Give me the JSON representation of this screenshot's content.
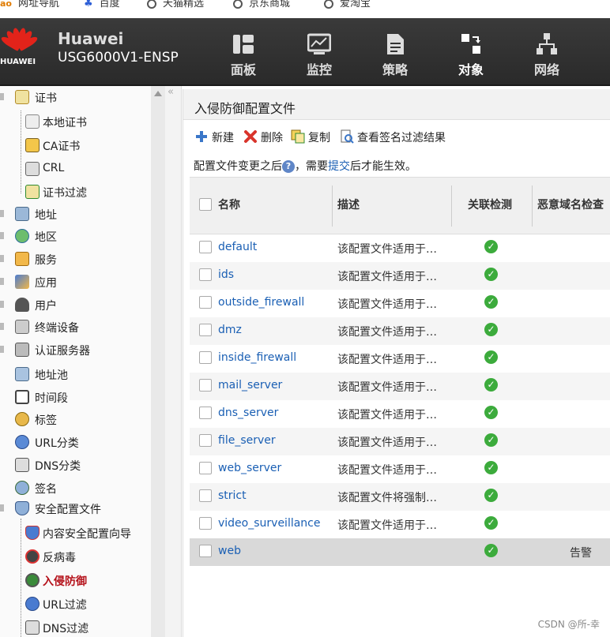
{
  "bookmarks": [
    "网址导航",
    "百度",
    "天猫精选",
    "京东商城",
    "爱淘宝"
  ],
  "header": {
    "logo_text": "HUAWEI",
    "brand": "Huawei",
    "model": "USG6000V1-ENSP",
    "nav": [
      {
        "label": "面板",
        "icon": "dashboard-icon"
      },
      {
        "label": "监控",
        "icon": "monitor-icon"
      },
      {
        "label": "策略",
        "icon": "policy-icon"
      },
      {
        "label": "对象",
        "icon": "object-icon",
        "active": true
      },
      {
        "label": "网络",
        "icon": "network-icon"
      }
    ]
  },
  "sidebar": {
    "items": [
      {
        "label": "证书",
        "level": "top",
        "icon": "certificate-icon"
      },
      {
        "label": "本地证书",
        "level": "child",
        "icon": "local-certificate-icon"
      },
      {
        "label": "CA证书",
        "level": "child",
        "icon": "ca-certificate-icon"
      },
      {
        "label": "CRL",
        "level": "child",
        "icon": "crl-icon"
      },
      {
        "label": "证书过滤",
        "level": "child",
        "icon": "certificate-filter-icon"
      },
      {
        "label": "地址",
        "level": "top",
        "icon": "address-icon"
      },
      {
        "label": "地区",
        "level": "top",
        "icon": "region-icon"
      },
      {
        "label": "服务",
        "level": "top",
        "icon": "service-icon"
      },
      {
        "label": "应用",
        "level": "top",
        "icon": "application-icon"
      },
      {
        "label": "用户",
        "level": "top",
        "icon": "user-icon"
      },
      {
        "label": "终端设备",
        "level": "top",
        "icon": "terminal-device-icon"
      },
      {
        "label": "认证服务器",
        "level": "top",
        "icon": "auth-server-icon"
      },
      {
        "label": "地址池",
        "level": "top",
        "icon": "address-pool-icon"
      },
      {
        "label": "时间段",
        "level": "top",
        "icon": "time-range-icon"
      },
      {
        "label": "标签",
        "level": "top",
        "icon": "tag-icon"
      },
      {
        "label": "URL分类",
        "level": "top",
        "icon": "url-category-icon"
      },
      {
        "label": "DNS分类",
        "level": "top",
        "icon": "dns-category-icon"
      },
      {
        "label": "签名",
        "level": "top",
        "icon": "signature-icon"
      },
      {
        "label": "安全配置文件",
        "level": "top",
        "icon": "security-profile-icon"
      },
      {
        "label": "内容安全配置向导",
        "level": "child",
        "icon": "content-security-wizard-icon"
      },
      {
        "label": "反病毒",
        "level": "child",
        "icon": "antivirus-icon"
      },
      {
        "label": "入侵防御",
        "level": "child",
        "icon": "intrusion-prevention-icon",
        "active": true
      },
      {
        "label": "URL过滤",
        "level": "child",
        "icon": "url-filter-icon"
      },
      {
        "label": "DNS过滤",
        "level": "child",
        "icon": "dns-filter-icon"
      }
    ]
  },
  "main": {
    "title": "入侵防御配置文件",
    "toolbar": {
      "new": "新建",
      "delete": "删除",
      "copy": "复制",
      "view_filter": "查看签名过滤结果"
    },
    "notice": {
      "before": "配置文件变更之后",
      "middle": "，需要",
      "link": "提交",
      "after": "后才能生效。"
    },
    "table": {
      "headers": [
        "名称",
        "描述",
        "关联检测",
        "恶意域名检查"
      ],
      "rows": [
        {
          "name": "default",
          "desc": "该配置文件适用于…",
          "linked": true,
          "malicious": ""
        },
        {
          "name": "ids",
          "desc": "该配置文件适用于…",
          "linked": true,
          "malicious": ""
        },
        {
          "name": "outside_firewall",
          "desc": "该配置文件适用于…",
          "linked": true,
          "malicious": ""
        },
        {
          "name": "dmz",
          "desc": "该配置文件适用于…",
          "linked": true,
          "malicious": ""
        },
        {
          "name": "inside_firewall",
          "desc": "该配置文件适用于…",
          "linked": true,
          "malicious": ""
        },
        {
          "name": "mail_server",
          "desc": "该配置文件适用于…",
          "linked": true,
          "malicious": ""
        },
        {
          "name": "dns_server",
          "desc": "该配置文件适用于…",
          "linked": true,
          "malicious": ""
        },
        {
          "name": "file_server",
          "desc": "该配置文件适用于…",
          "linked": true,
          "malicious": ""
        },
        {
          "name": "web_server",
          "desc": "该配置文件适用于…",
          "linked": true,
          "malicious": ""
        },
        {
          "name": "strict",
          "desc": "该配置文件将强制…",
          "linked": true,
          "malicious": ""
        },
        {
          "name": "video_surveillance",
          "desc": "该配置文件适用于…",
          "linked": true,
          "malicious": ""
        },
        {
          "name": "web",
          "desc": "",
          "linked": true,
          "malicious": "告警",
          "selected": true
        }
      ]
    }
  },
  "watermark": "CSDN @所-幸"
}
